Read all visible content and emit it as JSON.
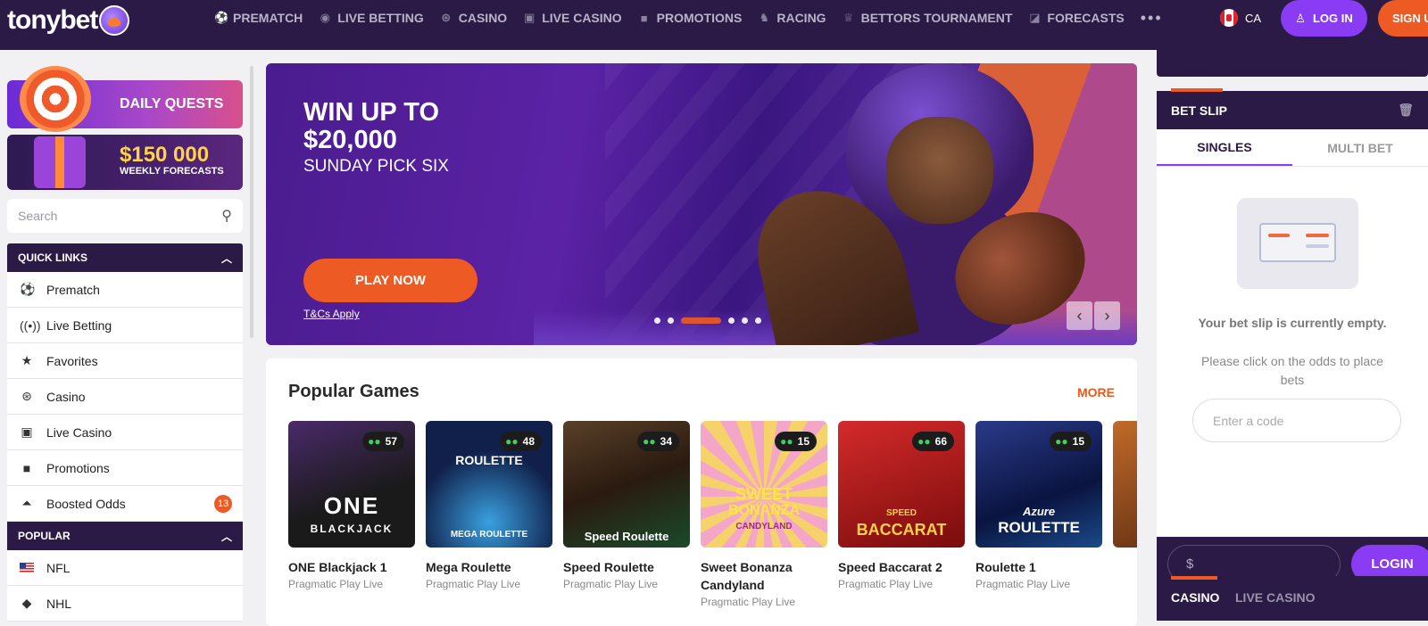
{
  "header": {
    "logo": "tonybet",
    "nav": [
      {
        "label": "PREMATCH",
        "icon": "soccer-ball-icon"
      },
      {
        "label": "LIVE BETTING",
        "icon": "live-icon"
      },
      {
        "label": "CASINO",
        "icon": "chip-icon"
      },
      {
        "label": "LIVE CASINO",
        "icon": "cards-icon"
      },
      {
        "label": "PROMOTIONS",
        "icon": "gift-icon"
      },
      {
        "label": "RACING",
        "icon": "horse-icon"
      },
      {
        "label": "BETTORS TOURNAMENT",
        "icon": "trophy-icon"
      },
      {
        "label": "FORECASTS",
        "icon": "forecast-icon"
      }
    ],
    "more": "•••",
    "lang": "CA",
    "login": "LOG IN",
    "signup": "SIGN U"
  },
  "left": {
    "quests": "DAILY QUESTS",
    "forecast_amount": "$150 000",
    "forecast_sub": "WEEKLY FORECASTS",
    "search_placeholder": "Search",
    "quick_links_title": "QUICK LINKS",
    "quick_links": [
      {
        "label": "Prematch",
        "icon": "soccer-ball-icon"
      },
      {
        "label": "Live Betting",
        "icon": "live-icon"
      },
      {
        "label": "Favorites",
        "icon": "star-icon"
      },
      {
        "label": "Casino",
        "icon": "chip-icon"
      },
      {
        "label": "Live Casino",
        "icon": "cards-icon"
      },
      {
        "label": "Promotions",
        "icon": "gift-icon"
      },
      {
        "label": "Boosted Odds",
        "icon": "boost-icon",
        "badge": "13"
      }
    ],
    "popular_title": "POPULAR",
    "popular": [
      {
        "label": "NFL"
      },
      {
        "label": "NHL"
      }
    ]
  },
  "hero": {
    "title": "WIN UP TO $20,000",
    "subtitle": "SUNDAY PICK SIX",
    "cta": "PLAY NOW",
    "terms": "T&Cs Apply",
    "active_slide": 3,
    "slides": 6
  },
  "games": {
    "title": "Popular Games",
    "more": "MORE",
    "items": [
      {
        "name": "ONE Blackjack 1",
        "provider": "Pragmatic Play Live",
        "players": "57",
        "bg": "#2a2a2a",
        "logo": "ONE BLACKJACK"
      },
      {
        "name": "Mega Roulette",
        "provider": "Pragmatic Play Live",
        "players": "48",
        "bg": "#10204a",
        "logo": "MEGA ROULETTE"
      },
      {
        "name": "Speed Roulette",
        "provider": "Pragmatic Play Live",
        "players": "34",
        "bg": "#3a2a1a",
        "logo": "Speed Roulette"
      },
      {
        "name": "Sweet Bonanza Candyland",
        "provider": "Pragmatic Play Live",
        "players": "15",
        "bg": "#e9a0c0",
        "logo": "SWEET BONANZA CANDYLAND"
      },
      {
        "name": "Speed Baccarat 2",
        "provider": "Pragmatic Play Live",
        "players": "66",
        "bg": "#b01818",
        "logo": "SPEED BACCARAT 2"
      },
      {
        "name": "Roulette 1",
        "provider": "Pragmatic Play Live",
        "players": "15",
        "bg": "#1a2a6a",
        "logo": "Azure ROULETTE"
      }
    ]
  },
  "betslip": {
    "title": "BET SLIP",
    "tab_singles": "SINGLES",
    "tab_multi": "MULTI BET",
    "empty": "Your bet slip is currently empty.",
    "hint": "Please click on the odds to place bets",
    "code_placeholder": "Enter a code",
    "currency": "$",
    "login": "LOGIN"
  },
  "casino_panel": {
    "tab_casino": "CASINO",
    "tab_live": "LIVE CASINO"
  }
}
